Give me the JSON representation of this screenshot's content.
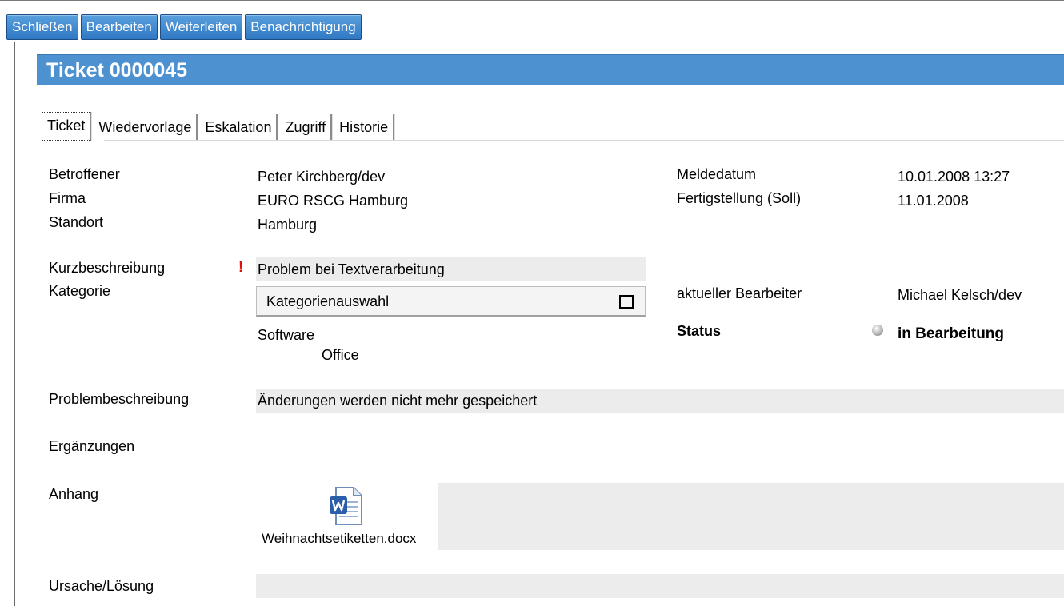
{
  "toolbar": {
    "close": "Schließen",
    "edit": "Bearbeiten",
    "forward": "Weiterleiten",
    "notify": "Benachrichtigung"
  },
  "title": "Ticket 0000045",
  "tabs": [
    "Ticket",
    "Wiedervorlage",
    "Eskalation",
    "Zugriff",
    "Historie"
  ],
  "labels": {
    "affected": "Betroffener",
    "company": "Firma",
    "location": "Standort",
    "short_description": "Kurzbeschreibung",
    "category": "Kategorie",
    "problem_description": "Problembeschreibung",
    "additions": "Ergänzungen",
    "attachment": "Anhang",
    "cause_solution": "Ursache/Lösung",
    "report_date": "Meldedatum",
    "due_date": "Fertigstellung (Soll)",
    "current_editor": "aktueller Bearbeiter",
    "status": "Status"
  },
  "values": {
    "affected": "Peter Kirchberg/dev",
    "company": "EURO RSCG Hamburg",
    "location": "Hamburg",
    "required_marker": "!",
    "short_description": "Problem bei Textverarbeitung",
    "category_select": "Kategorienauswahl",
    "category_level1": "Software",
    "category_level2": "Office",
    "problem_description": "Änderungen werden nicht mehr gespeichert",
    "report_date": "10.01.2008 13:27",
    "due_date": "11.01.2008",
    "current_editor": "Michael Kelsch/dev",
    "status": "in Bearbeitung"
  },
  "attachment": {
    "filename": "Weihnachtsetiketten.docx",
    "icon": "word-document-icon"
  },
  "colors": {
    "title_bar": "#4d91d1",
    "button": "#2f78c3",
    "field_bg": "#ececec",
    "required": "#e01010"
  }
}
